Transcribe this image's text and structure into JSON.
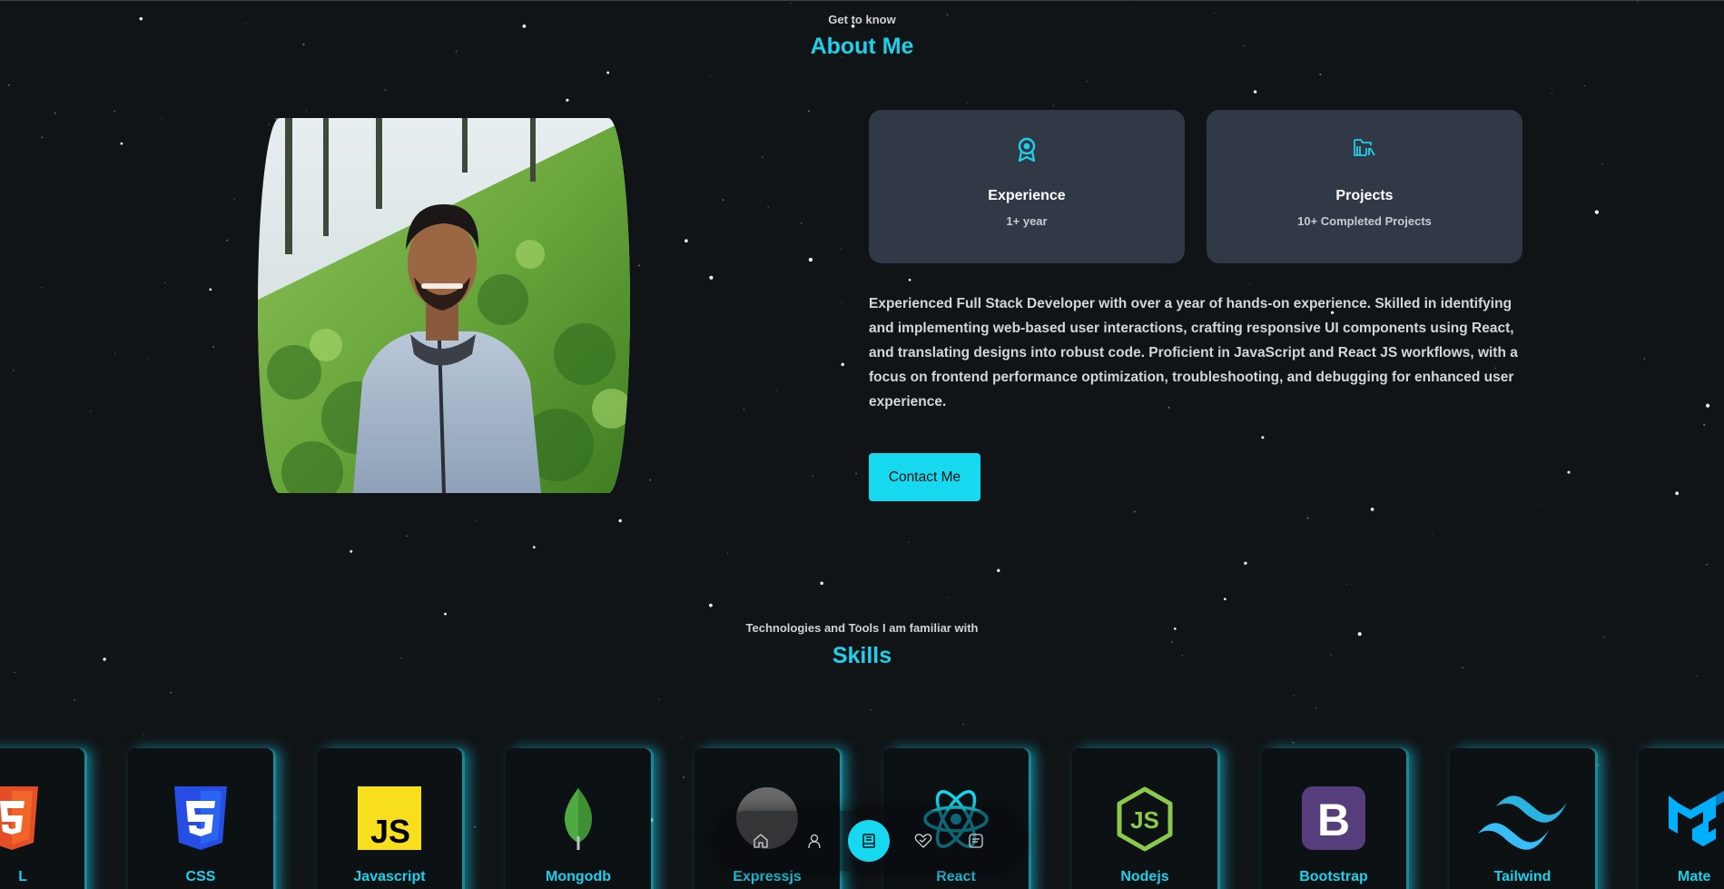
{
  "about": {
    "subtitle": "Get to know",
    "title": "About Me",
    "cards": [
      {
        "icon": "award-icon",
        "title": "Experience",
        "value": "1+ year"
      },
      {
        "icon": "folder-icon",
        "title": "Projects",
        "value": "10+ Completed Projects"
      }
    ],
    "description": "Experienced Full Stack Developer with over a year of hands-on experience. Skilled in identifying and implementing web-based user interactions, crafting responsive UI components using React, and translating designs into robust code. Proficient in JavaScript and React JS workflows, with a focus on frontend performance optimization, troubleshooting, and debugging for enhanced user experience.",
    "contact_label": "Contact Me"
  },
  "skills": {
    "subtitle": "Technologies and Tools I am familiar with",
    "title": "Skills",
    "items": [
      {
        "name": "L",
        "icon": "html-icon"
      },
      {
        "name": "CSS",
        "icon": "css-icon"
      },
      {
        "name": "Javascript",
        "icon": "javascript-icon"
      },
      {
        "name": "Mongodb",
        "icon": "mongodb-icon"
      },
      {
        "name": "Expressjs",
        "icon": "expressjs-icon"
      },
      {
        "name": "React",
        "icon": "react-icon"
      },
      {
        "name": "Nodejs",
        "icon": "nodejs-icon"
      },
      {
        "name": "Bootstrap",
        "icon": "bootstrap-icon"
      },
      {
        "name": "Tailwind",
        "icon": "tailwind-icon"
      },
      {
        "name": "Mate",
        "icon": "material-ui-icon"
      }
    ]
  },
  "nav": {
    "items": [
      "home-icon",
      "user-icon",
      "book-icon",
      "services-icon",
      "message-icon"
    ],
    "active": "book-icon"
  },
  "colors": {
    "background": "#101417",
    "accent": "#16d9ef",
    "card": "#323946"
  }
}
